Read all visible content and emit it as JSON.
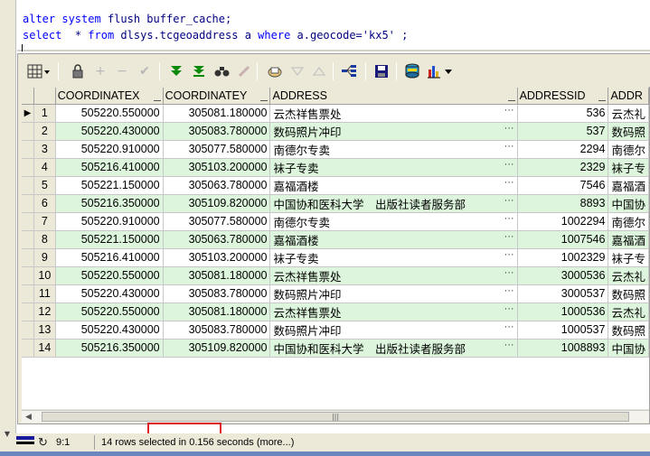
{
  "sql": {
    "line1": {
      "kw1": "alter",
      "kw2": "system",
      "rest": "flush buffer_cache;"
    },
    "line2": {
      "kw_select": "select",
      "star": "*",
      "kw_from": "from",
      "table": "dlsys.tcgeoaddress",
      "alias": "a",
      "kw_where": "where",
      "cond": "a.geocode=",
      "value": "'kx5'",
      "end": ";"
    }
  },
  "toolbar": {
    "icons": [
      "grid-options-icon",
      "lock-icon",
      "add-record-icon",
      "delete-record-icon",
      "post-icon",
      "fetch-next-icon",
      "fetch-last-icon",
      "find-icon",
      "clear-icon",
      "query-by-example-icon",
      "filter-icon",
      "sort-up-icon",
      "tree-icon",
      "save-icon",
      "export-icon",
      "chart-icon"
    ]
  },
  "grid": {
    "columns": [
      "",
      "COORDINATEX",
      "COORDINATEY",
      "ADDRESS",
      "ADDRESSID",
      "ADDR"
    ],
    "ellipsis": "···",
    "rows": [
      {
        "n": "1",
        "x": "505220.550000",
        "y": "305081.180000",
        "address": "云杰祥售票处",
        "id": "536",
        "addr2": "云杰礼"
      },
      {
        "n": "2",
        "x": "505220.430000",
        "y": "305083.780000",
        "address": "数码照片冲印",
        "id": "537",
        "addr2": "数码照"
      },
      {
        "n": "3",
        "x": "505220.910000",
        "y": "305077.580000",
        "address": "南德尔专卖",
        "id": "2294",
        "addr2": "南德尔"
      },
      {
        "n": "4",
        "x": "505216.410000",
        "y": "305103.200000",
        "address": "袜子专卖",
        "id": "2329",
        "addr2": "袜子专"
      },
      {
        "n": "5",
        "x": "505221.150000",
        "y": "305063.780000",
        "address": "嘉福酒楼",
        "id": "7546",
        "addr2": "嘉福酒"
      },
      {
        "n": "6",
        "x": "505216.350000",
        "y": "305109.820000",
        "address": "中国协和医科大学　出版社读者服务部",
        "id": "8893",
        "addr2": "中国协"
      },
      {
        "n": "7",
        "x": "505220.910000",
        "y": "305077.580000",
        "address": "南德尔专卖",
        "id": "1002294",
        "addr2": "南德尔"
      },
      {
        "n": "8",
        "x": "505221.150000",
        "y": "305063.780000",
        "address": "嘉福酒楼",
        "id": "1007546",
        "addr2": "嘉福酒"
      },
      {
        "n": "9",
        "x": "505216.410000",
        "y": "305103.200000",
        "address": "袜子专卖",
        "id": "1002329",
        "addr2": "袜子专"
      },
      {
        "n": "10",
        "x": "505220.550000",
        "y": "305081.180000",
        "address": "云杰祥售票处",
        "id": "3000536",
        "addr2": "云杰礼"
      },
      {
        "n": "11",
        "x": "505220.430000",
        "y": "305083.780000",
        "address": "数码照片冲印",
        "id": "3000537",
        "addr2": "数码照"
      },
      {
        "n": "12",
        "x": "505220.550000",
        "y": "305081.180000",
        "address": "云杰祥售票处",
        "id": "1000536",
        "addr2": "云杰礼"
      },
      {
        "n": "13",
        "x": "505220.430000",
        "y": "305083.780000",
        "address": "数码照片冲印",
        "id": "1000537",
        "addr2": "数码照"
      },
      {
        "n": "14",
        "x": "505216.350000",
        "y": "305109.820000",
        "address": "中国协和医科大学　出版社读者服务部",
        "id": "1008893",
        "addr2": "中国协"
      }
    ]
  },
  "statusbar": {
    "position": "9:1",
    "message": "14 rows selected in 0.156 seconds (more...)"
  },
  "colors": {
    "keyword": "#0000ff",
    "row_alt": "#dcf5dc",
    "highlight": "#e02020"
  }
}
